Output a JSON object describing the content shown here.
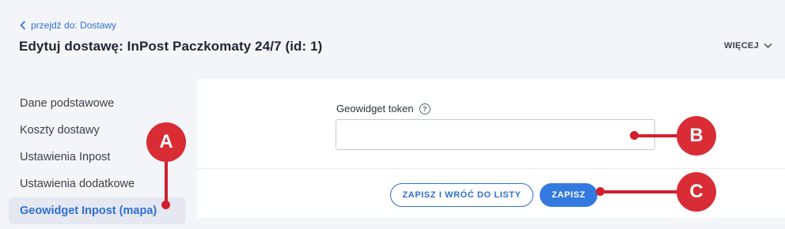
{
  "header": {
    "back_link": "przejdź do: Dostawy",
    "title": "Edytuj dostawę: InPost Paczkomaty 24/7 (id: 1)",
    "more_label": "WIĘCEJ"
  },
  "sidebar": {
    "items": [
      {
        "label": "Dane podstawowe",
        "active": false
      },
      {
        "label": "Koszty dostawy",
        "active": false
      },
      {
        "label": "Ustawienia Inpost",
        "active": false
      },
      {
        "label": "Ustawienia dodatkowe",
        "active": false
      },
      {
        "label": "Geowidget Inpost (mapa)",
        "active": true
      }
    ]
  },
  "form": {
    "token_label": "Geowidget token",
    "help_glyph": "?",
    "token_value": ""
  },
  "actions": {
    "save_and_back": "ZAPISZ I WRÓĆ DO LISTY",
    "save": "ZAPISZ"
  },
  "annotations": {
    "a": "A",
    "b": "B",
    "c": "C"
  },
  "colors": {
    "accent": "#2e6fd6",
    "primary_button": "#3479e0",
    "annotation": "#d92c35",
    "background": "#f4f5f8"
  }
}
